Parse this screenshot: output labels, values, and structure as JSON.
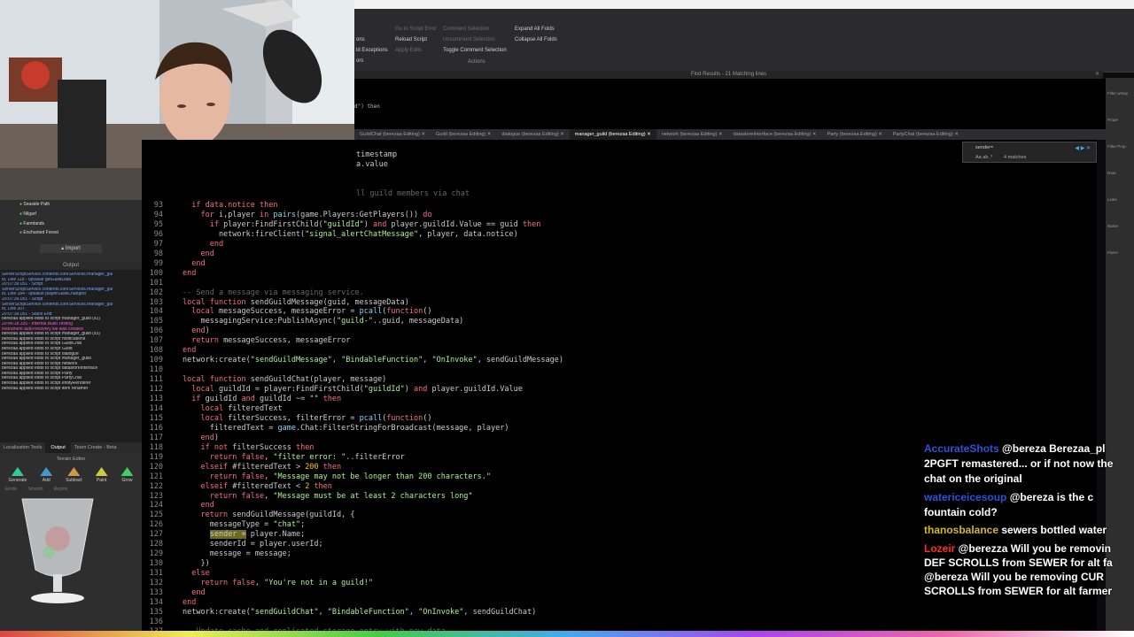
{
  "ribbon": {
    "items": [
      {
        "label": "Go to Script Error",
        "dim": true
      },
      {
        "label": "Reload Script",
        "dim": false
      },
      {
        "label": "Apply Edits",
        "dim": true
      },
      {
        "label": "Comment Selection",
        "dim": true
      },
      {
        "label": "Uncomment Selection",
        "dim": true
      },
      {
        "label": "Toggle Comment Selection",
        "dim": false
      },
      {
        "label": "Expand All Folds",
        "dim": false
      },
      {
        "label": "Collapse All Folds",
        "dim": false
      }
    ],
    "left_items": [
      "ons",
      "ld Exceptions",
      "ors"
    ],
    "group_label": "Actions"
  },
  "find_results_title": "Find Results - 21 Matching lines",
  "find_widget": {
    "query": "sender=",
    "options": "Aa  ab  .*",
    "matches": "4 matches"
  },
  "tabs": [
    {
      "label": "GuildChat (berezaa Editing)",
      "active": false
    },
    {
      "label": "Guild (berezaa Editing)",
      "active": false
    },
    {
      "label": "dialogue (berezaa Editing)",
      "active": false
    },
    {
      "label": "manager_guild (berezaa Editing)",
      "active": true
    },
    {
      "label": "network (berezaa Editing)",
      "active": false
    },
    {
      "label": "datastoreInterface (berezaa Editing)",
      "active": false
    },
    {
      "label": "Party (berezaa Editing)",
      "active": false
    },
    {
      "label": "PartyChat (berezaa Editing)",
      "active": false
    }
  ],
  "snippets": [
    {
      "text": "timestamp"
    },
    {
      "text": "a.value"
    },
    {
      "text": "ll guild members via chat"
    },
    {
      "text": "d\") then"
    }
  ],
  "code": [
    {
      "n": "93",
      "segs": [
        [
          "  if data.notice then",
          "k"
        ]
      ]
    },
    {
      "n": "94",
      "segs": [
        [
          "    for ",
          "k"
        ],
        [
          "i,player ",
          ""
        ],
        [
          "in ",
          "k"
        ],
        [
          "pairs",
          "b"
        ],
        [
          "(game.Players:GetPlayers()) ",
          ""
        ],
        [
          "do",
          "k"
        ]
      ]
    },
    {
      "n": "95",
      "segs": [
        [
          "      if ",
          "k"
        ],
        [
          "player:FindFirstChild(",
          ""
        ],
        [
          "\"guildId\"",
          "s"
        ],
        [
          ") ",
          ""
        ],
        [
          "and ",
          "k"
        ],
        [
          "player.guildId.Value == guid ",
          ""
        ],
        [
          "then",
          "k"
        ]
      ]
    },
    {
      "n": "96",
      "segs": [
        [
          "        network:fireClient(",
          ""
        ],
        [
          "\"signal_alertChatMessage\"",
          "s"
        ],
        [
          ", player, data.notice)",
          ""
        ]
      ]
    },
    {
      "n": "97",
      "segs": [
        [
          "      end",
          "k"
        ]
      ]
    },
    {
      "n": "98",
      "segs": [
        [
          "    end",
          "k"
        ]
      ]
    },
    {
      "n": "99",
      "segs": [
        [
          "  end",
          "k"
        ]
      ]
    },
    {
      "n": "100",
      "segs": [
        [
          "end",
          "k"
        ]
      ]
    },
    {
      "n": "101",
      "segs": []
    },
    {
      "n": "102",
      "segs": [
        [
          "-- Send a message via messaging service.",
          "c"
        ]
      ]
    },
    {
      "n": "103",
      "segs": [
        [
          "local function ",
          "k"
        ],
        [
          "sendGuildMessage",
          ""
        ],
        [
          "(guid, messageData)",
          ""
        ]
      ]
    },
    {
      "n": "104",
      "segs": [
        [
          "  local ",
          "k"
        ],
        [
          "messageSuccess, messageError = ",
          ""
        ],
        [
          "pcall",
          "b"
        ],
        [
          "(",
          ""
        ],
        [
          "function",
          "k"
        ],
        [
          "()",
          ""
        ]
      ]
    },
    {
      "n": "105",
      "segs": [
        [
          "    messagingService:PublishAsync(",
          ""
        ],
        [
          "\"guild-\"",
          "s"
        ],
        [
          "..guid, messageData)",
          ""
        ]
      ]
    },
    {
      "n": "106",
      "segs": [
        [
          "  end",
          "k"
        ],
        [
          ")",
          ""
        ]
      ]
    },
    {
      "n": "107",
      "segs": [
        [
          "  return ",
          "k"
        ],
        [
          "messageSuccess, messageError",
          ""
        ]
      ]
    },
    {
      "n": "108",
      "segs": [
        [
          "end",
          "k"
        ]
      ]
    },
    {
      "n": "109",
      "segs": [
        [
          "network:create(",
          ""
        ],
        [
          "\"sendGuildMessage\"",
          "s"
        ],
        [
          ", ",
          ""
        ],
        [
          "\"BindableFunction\"",
          "s"
        ],
        [
          ", ",
          ""
        ],
        [
          "\"OnInvoke\"",
          "s"
        ],
        [
          ", sendGuildMessage)",
          ""
        ]
      ]
    },
    {
      "n": "110",
      "segs": []
    },
    {
      "n": "111",
      "segs": [
        [
          "local function ",
          "k"
        ],
        [
          "sendGuildChat",
          ""
        ],
        [
          "(player, message)",
          ""
        ]
      ]
    },
    {
      "n": "112",
      "segs": [
        [
          "  local ",
          "k"
        ],
        [
          "guildId = player:FindFirstChild(",
          ""
        ],
        [
          "\"guildId\"",
          "s"
        ],
        [
          ") ",
          ""
        ],
        [
          "and ",
          "k"
        ],
        [
          "player.guildId.Value",
          ""
        ]
      ]
    },
    {
      "n": "113",
      "segs": [
        [
          "  if ",
          "k"
        ],
        [
          "guildId ",
          ""
        ],
        [
          "and ",
          "k"
        ],
        [
          "guildId ~= ",
          ""
        ],
        [
          "\"\" ",
          "s"
        ],
        [
          "then",
          "k"
        ]
      ]
    },
    {
      "n": "114",
      "segs": [
        [
          "    local ",
          "k"
        ],
        [
          "filteredText",
          ""
        ]
      ]
    },
    {
      "n": "115",
      "segs": [
        [
          "    local ",
          "k"
        ],
        [
          "filterSuccess, filterError = ",
          ""
        ],
        [
          "pcall",
          "b"
        ],
        [
          "(",
          ""
        ],
        [
          "function",
          "k"
        ],
        [
          "()",
          ""
        ]
      ]
    },
    {
      "n": "116",
      "segs": [
        [
          "      filteredText = ",
          ""
        ],
        [
          "game",
          "b"
        ],
        [
          ".Chat:FilterStringForBroadcast(message, player)",
          ""
        ]
      ]
    },
    {
      "n": "117",
      "segs": [
        [
          "    end",
          "k"
        ],
        [
          ")",
          ""
        ]
      ]
    },
    {
      "n": "118",
      "segs": [
        [
          "    if not ",
          "k"
        ],
        [
          "filterSuccess ",
          ""
        ],
        [
          "then",
          "k"
        ]
      ]
    },
    {
      "n": "119",
      "segs": [
        [
          "      return false",
          "k"
        ],
        [
          ", ",
          ""
        ],
        [
          "\"filter error: \"",
          "s"
        ],
        [
          "..filterError",
          ""
        ]
      ]
    },
    {
      "n": "120",
      "segs": [
        [
          "    elseif ",
          "k"
        ],
        [
          "#filteredText > ",
          ""
        ],
        [
          "200 ",
          "n"
        ],
        [
          "then",
          "k"
        ]
      ]
    },
    {
      "n": "121",
      "segs": [
        [
          "      return false",
          "k"
        ],
        [
          ", ",
          ""
        ],
        [
          "\"Message may not be longer than 200 characters.\"",
          "s"
        ]
      ]
    },
    {
      "n": "122",
      "segs": [
        [
          "    elseif ",
          "k"
        ],
        [
          "#filteredText < ",
          ""
        ],
        [
          "2 ",
          "n"
        ],
        [
          "then",
          "k"
        ]
      ]
    },
    {
      "n": "123",
      "segs": [
        [
          "      return false",
          "k"
        ],
        [
          ", ",
          ""
        ],
        [
          "\"Message must be at least 2 characters long\"",
          "s"
        ]
      ]
    },
    {
      "n": "124",
      "segs": [
        [
          "    end",
          "k"
        ]
      ]
    },
    {
      "n": "125",
      "segs": [
        [
          "    return ",
          "k"
        ],
        [
          "sendGuildMessage(guildId, {",
          ""
        ]
      ]
    },
    {
      "n": "126",
      "segs": [
        [
          "      messageType = ",
          ""
        ],
        [
          "\"chat\"",
          "s"
        ],
        [
          ";",
          ""
        ]
      ]
    },
    {
      "n": "127",
      "segs": [
        [
          "      ",
          ""
        ],
        [
          "sender =",
          "hl"
        ],
        [
          " player.Name;",
          ""
        ]
      ]
    },
    {
      "n": "128",
      "segs": [
        [
          "      senderId = player.userId;",
          ""
        ]
      ]
    },
    {
      "n": "129",
      "segs": [
        [
          "      message = message;",
          ""
        ]
      ]
    },
    {
      "n": "130",
      "segs": [
        [
          "    })",
          ""
        ]
      ]
    },
    {
      "n": "131",
      "segs": [
        [
          "  else",
          "k"
        ]
      ]
    },
    {
      "n": "132",
      "segs": [
        [
          "    return false",
          "k"
        ],
        [
          ", ",
          ""
        ],
        [
          "\"You're not in a guild!\"",
          "s"
        ]
      ]
    },
    {
      "n": "133",
      "segs": [
        [
          "  end",
          "k"
        ]
      ]
    },
    {
      "n": "134",
      "segs": [
        [
          "end",
          "k"
        ]
      ]
    },
    {
      "n": "135",
      "segs": [
        [
          "network:create(",
          ""
        ],
        [
          "\"sendGuildChat\"",
          "s"
        ],
        [
          ", ",
          ""
        ],
        [
          "\"BindableFunction\"",
          "s"
        ],
        [
          ", ",
          ""
        ],
        [
          "\"OnInvoke\"",
          "s"
        ],
        [
          ", sendGuildChat)",
          ""
        ]
      ]
    },
    {
      "n": "136",
      "segs": []
    },
    {
      "n": "137",
      "segs": [
        [
          "-- Update cache and replicated storage entry with new data",
          "c"
        ]
      ]
    }
  ],
  "explorer": {
    "items": [
      "Seaside Path",
      "Nilgarf",
      "Farmlands",
      "Enchanted Forest"
    ],
    "import_label": "Import"
  },
  "output": {
    "title": "Output",
    "lines": [
      {
        "t": "ServerScriptService.contents.coreServices.manager_gui",
        "c": "#7aa7ff"
      },
      {
        "t": "ld, Line 118 - upvalue getGuildData",
        "c": "#7aa7ff"
      },
      {
        "t": "20:07:39.051 - Script",
        "c": "#7aa7ff"
      },
      {
        "t": "ServerScriptService.contents.coreServices.manager_gui",
        "c": "#7aa7ff"
      },
      {
        "t": "ld, Line 184 - upvalue playerGuildChanged",
        "c": "#7aa7ff"
      },
      {
        "t": "20:07:39.051 - Script",
        "c": "#7aa7ff"
      },
      {
        "t": "ServerScriptService.contents.coreServices.manager_gui",
        "c": "#7aa7ff"
      },
      {
        "t": "ld, Line 207",
        "c": "#7aa7ff"
      },
      {
        "t": "20:07:39.051 - Stack End",
        "c": "#7aa7ff"
      },
      {
        "t": "berezaa applied edits to script manager_guild (x2)",
        "c": "#cfcfcf"
      },
      {
        "t": "20:46:18.335 - Internal Build Testing",
        "c": "#ff5ad9"
      },
      {
        "t": "Instrument auto-recovery file was created",
        "c": "#ff5ad9"
      },
      {
        "t": "berezaa applied edits to script manager_guild (x3)",
        "c": "#cfcfcf"
      },
      {
        "t": "berezaa applied edits to script notifications",
        "c": "#cfcfcf"
      },
      {
        "t": "berezaa applied edits to script GuildChat",
        "c": "#cfcfcf"
      },
      {
        "t": "berezaa applied edits to script Guild",
        "c": "#cfcfcf"
      },
      {
        "t": "berezaa applied edits to script dialogue",
        "c": "#cfcfcf"
      },
      {
        "t": "berezaa applied edits to script manager_guild",
        "c": "#cfcfcf"
      },
      {
        "t": "berezaa applied edits to script network",
        "c": "#cfcfcf"
      },
      {
        "t": "berezaa applied edits to script datastoreInterface",
        "c": "#cfcfcf"
      },
      {
        "t": "berezaa applied edits to script Party",
        "c": "#cfcfcf"
      },
      {
        "t": "berezaa applied edits to script PartyChat",
        "c": "#cfcfcf"
      },
      {
        "t": "berezaa applied edits to script entityRenderer",
        "c": "#cfcfcf"
      },
      {
        "t": "berezaa applied edits to script item renamer",
        "c": "#cfcfcf"
      }
    ]
  },
  "bottom_tabs": [
    "Localization Tools",
    "Output",
    "Team Create - Beta"
  ],
  "terrain": {
    "title": "Terrain Editor",
    "tools": [
      {
        "label": "Generate",
        "color": "#3c9"
      },
      {
        "label": "Add",
        "color": "#49c"
      },
      {
        "label": "Subtract",
        "color": "#c94"
      },
      {
        "label": "Paint",
        "color": "#cc4"
      },
      {
        "label": "Grow",
        "color": "#4c6"
      }
    ],
    "tools2": [
      "Erode",
      "Smooth",
      "Region"
    ]
  },
  "chat": [
    {
      "user": "AccurateShots",
      "ucolor": "#2c52d9",
      "msg": "@bereza Berezaa_pl"
    },
    {
      "user": "",
      "ucolor": "#fff",
      "msg": "2PGFT remastered... or if not now the"
    },
    {
      "user": "",
      "ucolor": "#fff",
      "msg": "chat on the original"
    },
    {
      "user": "watericeicesoup",
      "ucolor": "#2c52d9",
      "msg": "@bereza is the c"
    },
    {
      "user": "",
      "ucolor": "#fff",
      "msg": "fountain cold?"
    },
    {
      "user": "thanosbalance",
      "ucolor": "#d6b62b",
      "msg": "sewers bottled water"
    },
    {
      "user": "Lozeir",
      "ucolor": "#ff2a2a",
      "msg": "@berezza Will you be removin"
    },
    {
      "user": "",
      "ucolor": "#fff",
      "msg": "DEF SCROLLS from SEWER for alt fa"
    },
    {
      "user": "",
      "ucolor": "#fff",
      "msg": "@bereza Will you be removing CUR"
    },
    {
      "user": "",
      "ucolor": "#fff",
      "msg": "SCROLLS from SEWER for alt farmer"
    }
  ],
  "right_panel": [
    "Filter wrksp",
    "Prope",
    "Filter Prop",
    "Data",
    "Linke",
    "Name",
    "Paren"
  ]
}
